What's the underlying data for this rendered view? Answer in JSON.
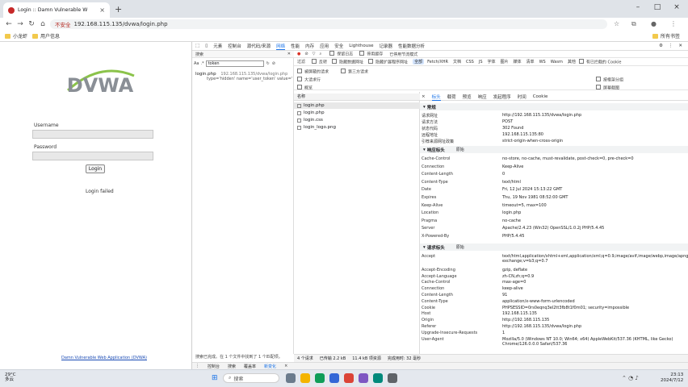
{
  "browser": {
    "tab_title": "Login :: Damn Vulnerable W",
    "tab_close": "×",
    "new_tab": "+",
    "url_warning": "不安全",
    "url": "192.168.115.135/dvwa/login.php",
    "bookmarks": [
      "小龙虾",
      "用户信息"
    ],
    "all_bookmarks": "所有书签",
    "window_controls": [
      "–",
      "□",
      "×"
    ]
  },
  "page": {
    "logo_text": "DVWA",
    "username_label": "Username",
    "password_label": "Password",
    "login_button": "Login",
    "message": "Login failed",
    "footer": "Damn Vulnerable Web Application (DVWA)"
  },
  "devtools": {
    "tabs": [
      "元素",
      "控制台",
      "源代码/来源",
      "网络",
      "性能",
      "内存",
      "应用",
      "安全",
      "Lighthouse",
      "记录器",
      "性能数据分析"
    ],
    "active_tab": "网络",
    "search_panel": {
      "title": "搜索",
      "query": "token",
      "results": [
        {
          "file": "login.php",
          "path": "192.168.115.135/dvwa/login.php",
          "snippet": "type='hidden' name='user_token' value='..."
        }
      ],
      "status": "搜索已完成。在 1 个文件中找到了 1 个匹配项。"
    },
    "network_toolbar": {
      "preserve_log": "保留日志",
      "disable_cache": "停用缓存",
      "throttle": "已停用节流模式"
    },
    "filter": {
      "placeholder": "过滤",
      "invert": "反转",
      "hide_data_urls": "隐藏数据网址",
      "hide_extension_urls": "隐藏扩展程序网址",
      "chips": [
        "全部",
        "Fetch/XHR",
        "文档",
        "CSS",
        "JS",
        "字体",
        "图片",
        "媒体",
        "清单",
        "WS",
        "Wasm",
        "其他"
      ],
      "blocked_cookies": "有已拦截的 Cookie"
    },
    "options": {
      "blocked_requests": "被屏蔽的请求",
      "third_party": "第三方请求",
      "big_rows": "大请求行",
      "group_by_frame": "按框架分组",
      "overview": "概览",
      "screenshots": "屏幕截图"
    },
    "request_list": {
      "header": "名称",
      "items": [
        "login.php",
        "login.php",
        "login.css",
        "login_logo.png"
      ]
    },
    "detail_tabs": [
      "×",
      "标头",
      "载荷",
      "预览",
      "响应",
      "发起程序",
      "时间",
      "Cookie"
    ],
    "general": {
      "title": "常规",
      "rows": [
        {
          "k": "请求网址",
          "v": "http://192.168.115.135/dvwa/login.php"
        },
        {
          "k": "请求方法",
          "v": "POST"
        },
        {
          "k": "状态代码",
          "v": "302 Found"
        },
        {
          "k": "远程地址",
          "v": "192.168.115.135:80"
        },
        {
          "k": "引荐来源网址政策",
          "v": "strict-origin-when-cross-origin"
        }
      ]
    },
    "response_headers": {
      "title": "响应标头",
      "raw": "原始",
      "rows": [
        {
          "k": "Cache-Control",
          "v": "no-store, no-cache, must-revalidate, post-check=0, pre-check=0"
        },
        {
          "k": "Connection",
          "v": "Keep-Alive"
        },
        {
          "k": "Content-Length",
          "v": "0"
        },
        {
          "k": "Content-Type",
          "v": "text/html"
        },
        {
          "k": "Date",
          "v": "Fri, 12 Jul 2024 15:13:22 GMT"
        },
        {
          "k": "Expires",
          "v": "Thu, 19 Nov 1981 08:52:00 GMT"
        },
        {
          "k": "Keep-Alive",
          "v": "timeout=5, max=100"
        },
        {
          "k": "Location",
          "v": "login.php"
        },
        {
          "k": "Pragma",
          "v": "no-cache"
        },
        {
          "k": "Server",
          "v": "Apache/2.4.23 (Win32) OpenSSL/1.0.2j PHP/5.4.45"
        },
        {
          "k": "X-Powered-By",
          "v": "PHP/5.4.45"
        }
      ]
    },
    "request_headers": {
      "title": "请求标头",
      "raw": "原始",
      "rows": [
        {
          "k": "Accept",
          "v": "text/html,application/xhtml+xml,application/xml;q=0.9,image/avif,image/webp,image/apng,*/*;q=0.8,application/signed-exchange;v=b3;q=0.7"
        },
        {
          "k": "Accept-Encoding",
          "v": "gzip, deflate"
        },
        {
          "k": "Accept-Language",
          "v": "zh-CN,zh;q=0.9"
        },
        {
          "k": "Cache-Control",
          "v": "max-age=0"
        },
        {
          "k": "Connection",
          "v": "keep-alive"
        },
        {
          "k": "Content-Length",
          "v": "91"
        },
        {
          "k": "Content-Type",
          "v": "application/x-www-form-urlencoded"
        },
        {
          "k": "Cookie",
          "v": "PHPSESSID=0rs0eqnq3el2tt3fb8t1f0m01; security=impossible"
        },
        {
          "k": "Host",
          "v": "192.168.115.135"
        },
        {
          "k": "Origin",
          "v": "http://192.168.115.135"
        },
        {
          "k": "Referer",
          "v": "http://192.168.115.135/dvwa/login.php"
        },
        {
          "k": "Upgrade-Insecure-Requests",
          "v": "1"
        },
        {
          "k": "User-Agent",
          "v": "Mozilla/5.0 (Windows NT 10.0; Win64; x64) AppleWebKit/537.36 (KHTML, like Gecko) Chrome/126.0.0.0 Safari/537.36"
        }
      ]
    },
    "status_bar": [
      "4 个请求",
      "已传输 2.2 kB",
      "11.4 kB 项资源",
      "完成用时: 32 毫秒"
    ],
    "drawer_tabs": [
      "控制台",
      "搜索",
      "覆盖率",
      "新变化",
      "×"
    ]
  },
  "taskbar": {
    "temp": "29°C",
    "weather": "多云",
    "search": "搜索",
    "time": "23:13",
    "date": "2024/7/12"
  }
}
